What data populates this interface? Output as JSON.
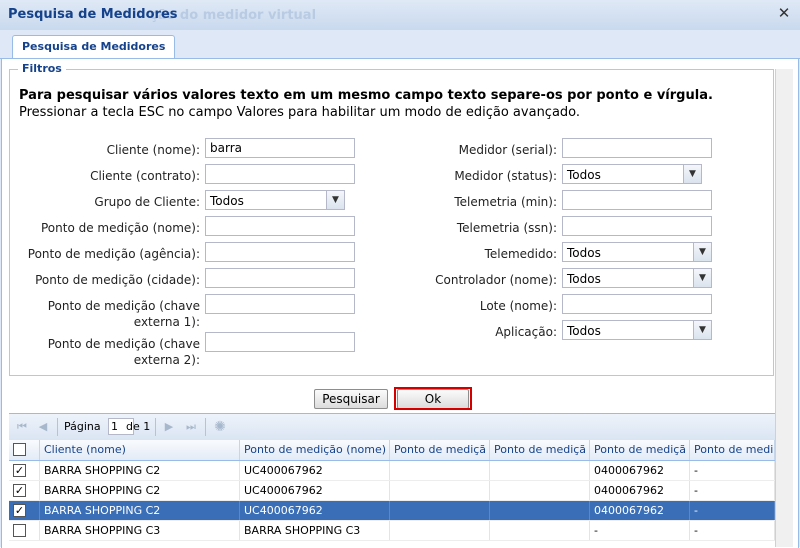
{
  "window": {
    "title": "Pesquisa de Medidores",
    "background_title": "ção do medidor virtual"
  },
  "tabs": [
    {
      "label": "Pesquisa de Medidores",
      "active": true
    }
  ],
  "filters": {
    "legend": "Filtros",
    "info_bold": "Para pesquisar vários valores texto em um mesmo campo texto separe-os por ponto e vírgula.",
    "info_normal": "Pressionar a tecla ESC no campo Valores para habilitar um modo de edição avançado.",
    "left": [
      {
        "label": "Cliente (nome):",
        "type": "text",
        "value": "barra"
      },
      {
        "label": "Cliente (contrato):",
        "type": "text",
        "value": ""
      },
      {
        "label": "Grupo de Cliente:",
        "type": "combo",
        "value": "Todos"
      },
      {
        "label": "Ponto de medição (nome):",
        "type": "text",
        "value": ""
      },
      {
        "label": "Ponto de medição (agência):",
        "type": "text",
        "value": ""
      },
      {
        "label": "Ponto de medição (cidade):",
        "type": "text",
        "value": ""
      },
      {
        "label1": "Ponto de medição (chave",
        "label2": "externa 1):",
        "type": "text",
        "value": ""
      },
      {
        "label1": "Ponto de medição (chave",
        "label2": "externa 2):",
        "type": "text",
        "value": ""
      }
    ],
    "right": [
      {
        "label": "Medidor (serial):",
        "type": "text",
        "value": ""
      },
      {
        "label": "Medidor (status):",
        "type": "combo",
        "value": "Todos"
      },
      {
        "label": "Telemetria (min):",
        "type": "text",
        "value": ""
      },
      {
        "label": "Telemetria (ssn):",
        "type": "text",
        "value": ""
      },
      {
        "label": "Telemedido:",
        "type": "combo",
        "value": "Todos"
      },
      {
        "label": "Controlador (nome):",
        "type": "combo",
        "value": "Todos"
      },
      {
        "label": "Lote (nome):",
        "type": "text",
        "value": ""
      },
      {
        "label": "Aplicação:",
        "type": "combo",
        "value": "Todos"
      }
    ]
  },
  "buttons": {
    "search": "Pesquisar",
    "ok": "Ok"
  },
  "paging": {
    "page_label": "Página",
    "page_value": "1",
    "of_label": "de 1"
  },
  "grid": {
    "columns": [
      "Cliente (nome)",
      "Ponto de medição (nome)",
      "Ponto de mediçã",
      "Ponto de mediçã",
      "Ponto de mediçã",
      "Ponto de medi"
    ],
    "rows": [
      {
        "checked": true,
        "selected": false,
        "cells": [
          "BARRA SHOPPING C2",
          "UC400067962",
          "",
          "",
          "0400067962",
          "-"
        ]
      },
      {
        "checked": true,
        "selected": false,
        "cells": [
          "BARRA SHOPPING C2",
          "UC400067962",
          "",
          "",
          "0400067962",
          "-"
        ]
      },
      {
        "checked": true,
        "selected": true,
        "cells": [
          "BARRA SHOPPING C2",
          "UC400067962",
          "",
          "",
          "0400067962",
          "-"
        ]
      },
      {
        "checked": false,
        "selected": false,
        "cells": [
          "BARRA SHOPPING C3",
          "BARRA SHOPPING C3",
          "",
          "",
          "-",
          "-"
        ]
      }
    ]
  },
  "colors": {
    "accent": "#15428b",
    "selection": "#3a6fb8",
    "highlight": "#d40000"
  }
}
